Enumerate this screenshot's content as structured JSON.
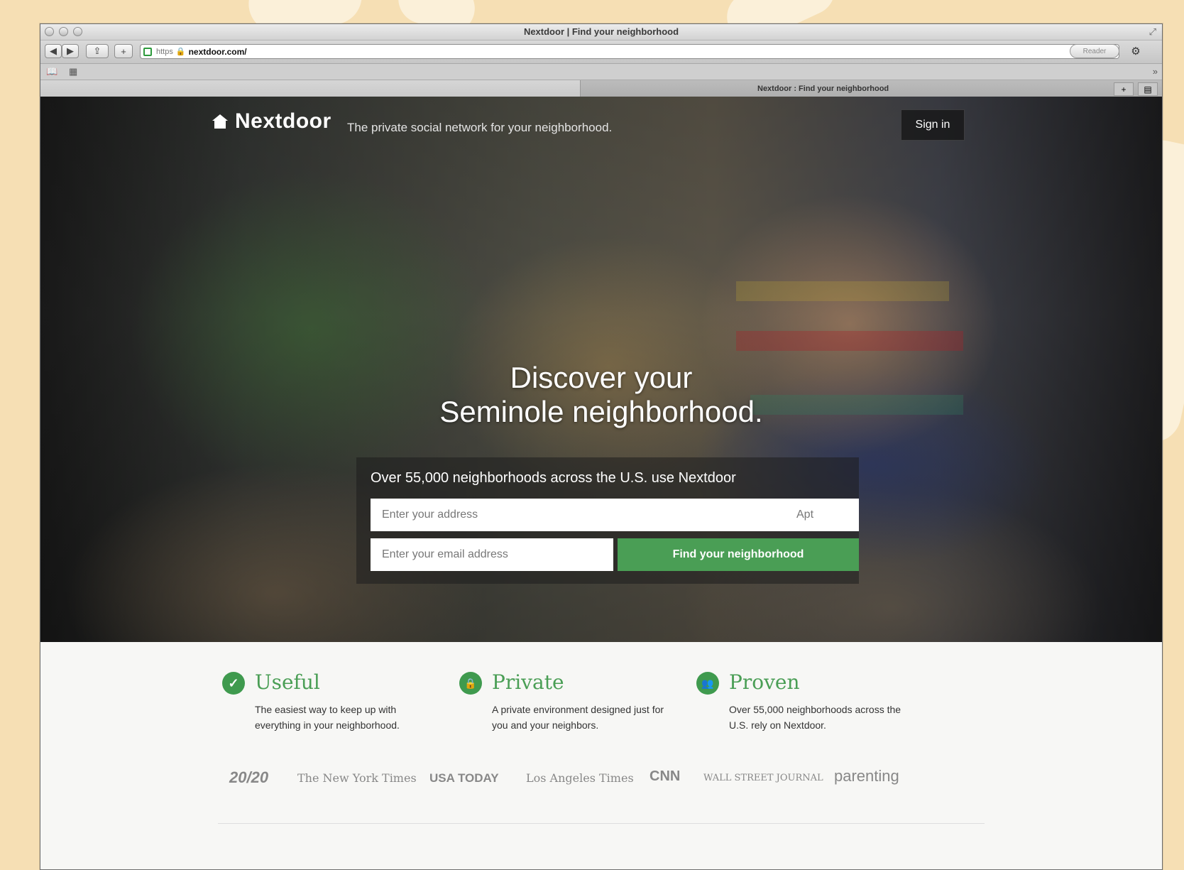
{
  "browser": {
    "window_title": "Nextdoor | Find your neighborhood",
    "url_scheme": "https",
    "url_host": "nextdoor.com/",
    "reader_label": "Reader",
    "tab_title": "Nextdoor : Find your neighborhood",
    "tab_add": "+",
    "tab_list": "▤",
    "chevron": "»"
  },
  "header": {
    "brand": "Nextdoor",
    "tagline": "The private social network for your neighborhood.",
    "signin": "Sign in"
  },
  "hero": {
    "headline_line1": "Discover your",
    "headline_line2": "Seminole neighborhood.",
    "intro": "Over 55,000 neighborhoods across the U.S. use Nextdoor",
    "address_placeholder": "Enter your address",
    "apt_placeholder": "Apt",
    "email_placeholder": "Enter your email address",
    "find_button": "Find your neighborhood"
  },
  "features": [
    {
      "icon": "check-icon",
      "glyph": "✓",
      "title": "Useful",
      "desc": "The easiest way to keep up with everything in your neighborhood."
    },
    {
      "icon": "lock-icon",
      "glyph": "🔒",
      "title": "Private",
      "desc": "A private environment designed just for you and your neighbors."
    },
    {
      "icon": "people-icon",
      "glyph": "👥",
      "title": "Proven",
      "desc": "Over 55,000 neighborhoods across the U.S. rely on Nextdoor."
    }
  ],
  "press": [
    "20/20",
    "The New York Times",
    "USA TODAY",
    "Los Angeles Times",
    "CNN",
    "WALL STREET JOURNAL",
    "parenting"
  ],
  "colors": {
    "accent_green": "#4a9e55",
    "page_background": "#f6dfb4"
  }
}
